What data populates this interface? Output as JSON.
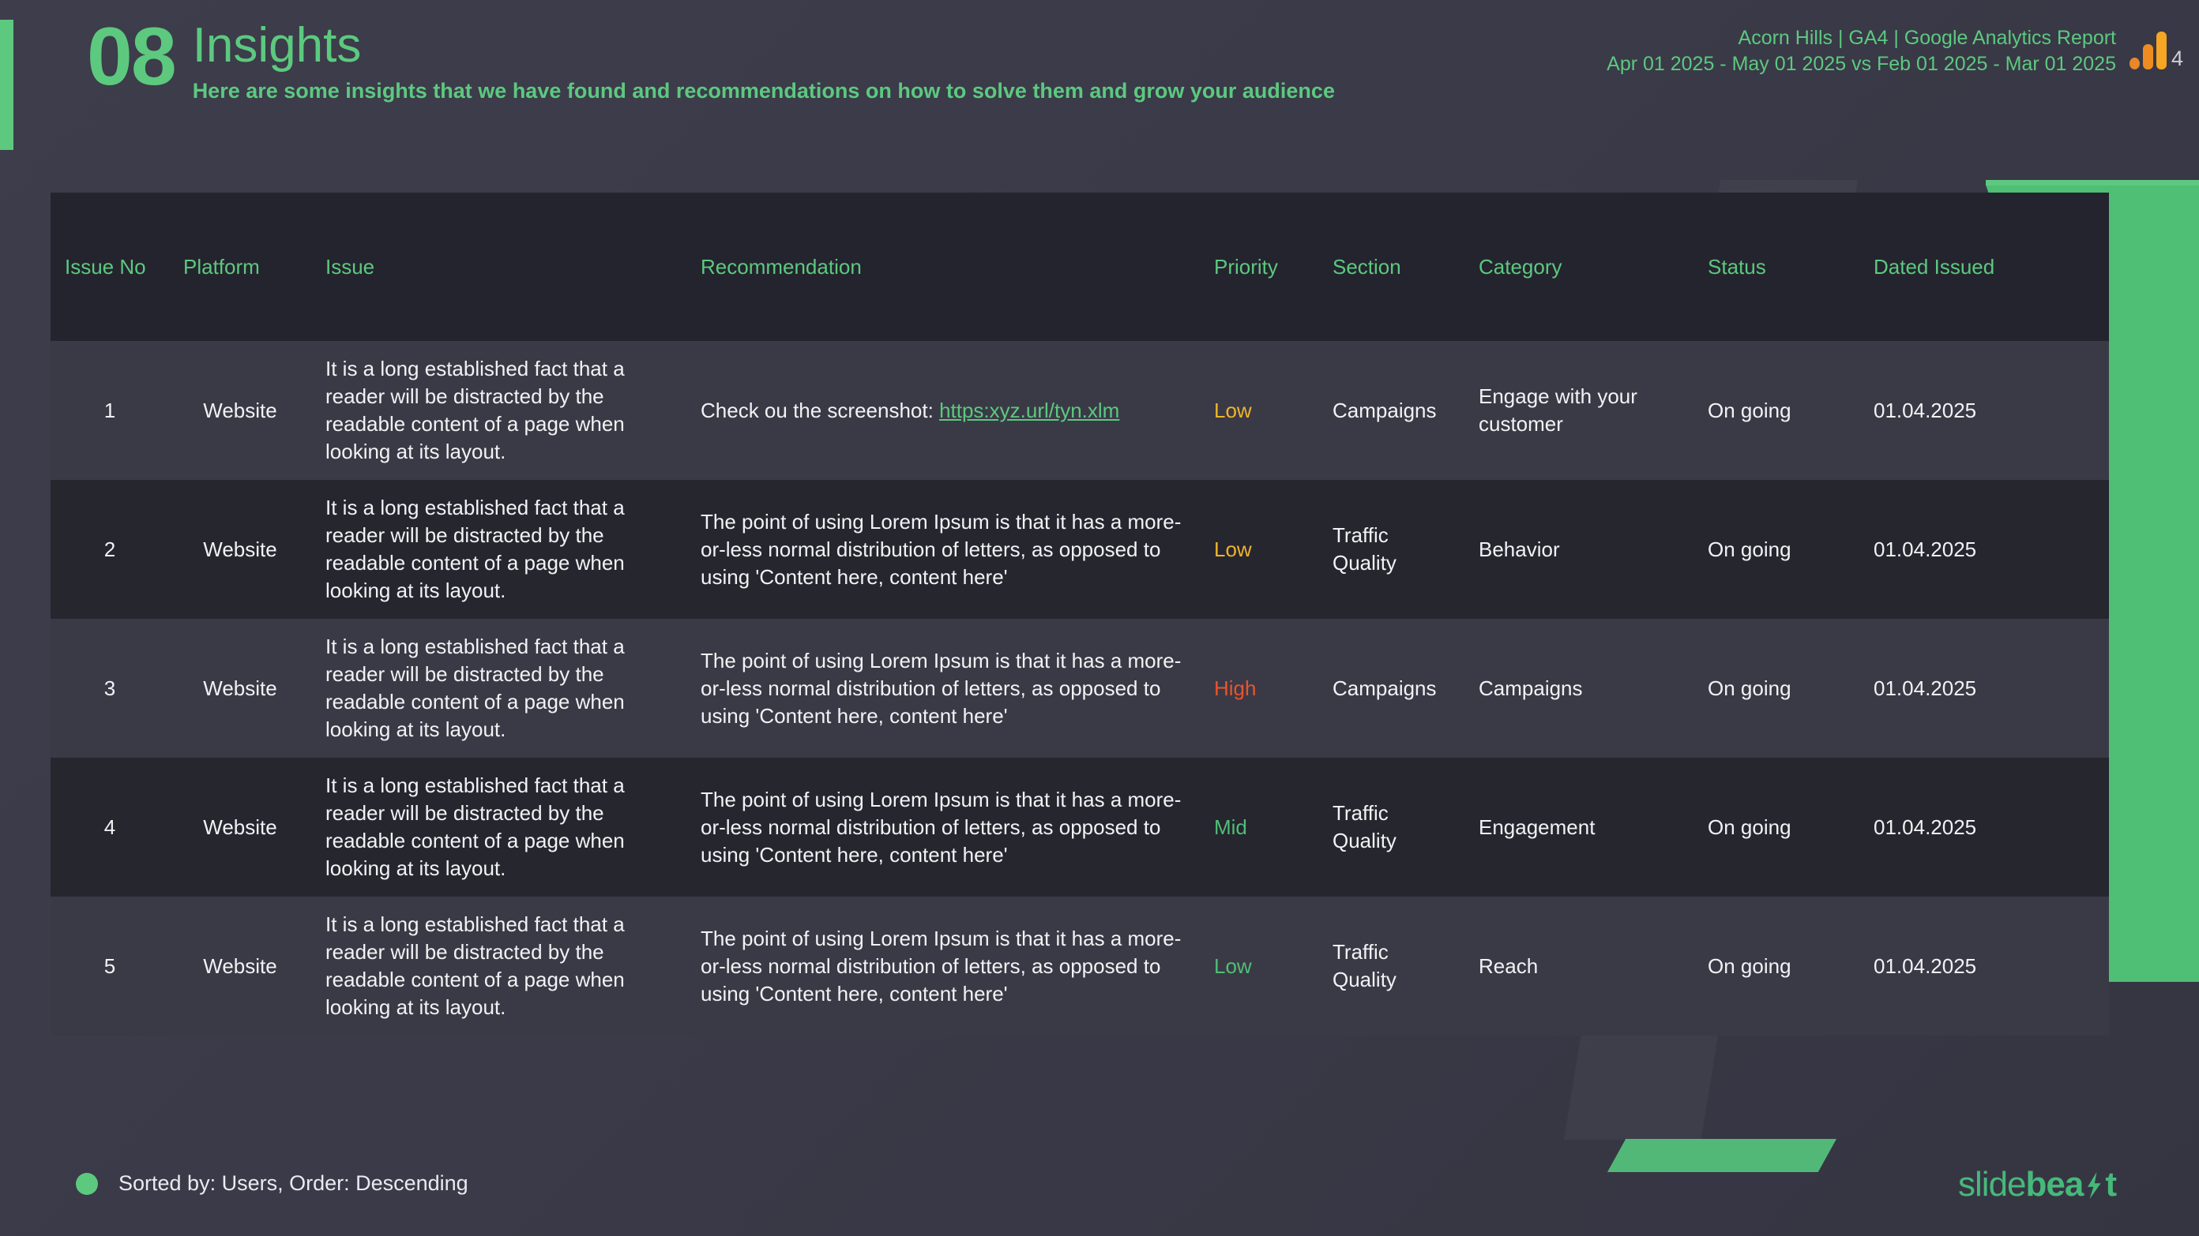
{
  "header": {
    "slide_number": "08",
    "title": "Insights",
    "subtitle": "Here are some insights that we have found and recommendations on how to solve them and grow your audience",
    "report_name": "Acorn Hills | GA4 | Google Analytics Report",
    "date_range": "Apr 01 2025 - May 01 2025 vs Feb 01 2025 - Mar 01 2025",
    "ga4_logo_label": "4"
  },
  "table": {
    "columns": [
      "Issue No",
      "Platform",
      "Issue",
      "Recommendation",
      "Priority",
      "Section",
      "Category",
      "Status",
      "Dated Issued"
    ],
    "rows": [
      {
        "issue_no": "1",
        "platform": "Website",
        "issue": "It is a long established fact that a reader will be distracted by the readable content of a page when looking at its layout.",
        "recommendation_prefix": "Check ou the screenshot: ",
        "recommendation_link": "https:xyz.url/tyn.xlm",
        "priority": "Low",
        "priority_color": "#f0b429",
        "section": "Campaigns",
        "category": "Engage with your customer",
        "status": "On going",
        "date_issued": "01.04.2025"
      },
      {
        "issue_no": "2",
        "platform": "Website",
        "issue": "It is a long established fact that a reader will be distracted by the readable content of a page when looking at its layout.",
        "recommendation_prefix": "The point of using Lorem Ipsum is that it has a more-or-less normal distribution of letters, as opposed to using 'Content here, content here'",
        "recommendation_link": "",
        "priority": "Low",
        "priority_color": "#f0b429",
        "section": "Traffic Quality",
        "category": "Behavior",
        "status": "On going",
        "date_issued": "01.04.2025"
      },
      {
        "issue_no": "3",
        "platform": "Website",
        "issue": "It is a long established fact that a reader will be distracted by the readable content of a page when looking at its layout.",
        "recommendation_prefix": "The point of using Lorem Ipsum is that it has a more-or-less normal distribution of letters, as opposed to using 'Content here, content here'",
        "recommendation_link": "",
        "priority": "High",
        "priority_color": "#e8542f",
        "section": "Campaigns",
        "category": "Campaigns",
        "status": "On going",
        "date_issued": "01.04.2025"
      },
      {
        "issue_no": "4",
        "platform": "Website",
        "issue": "It is a long established fact that a reader will be distracted by the readable content of a page when looking at its layout.",
        "recommendation_prefix": "The point of using Lorem Ipsum is that it has a more-or-less normal distribution of letters, as opposed to using 'Content here, content here'",
        "recommendation_link": "",
        "priority": "Mid",
        "priority_color": "#4fbf76",
        "section": "Traffic Quality",
        "category": "Engagement",
        "status": "On going",
        "date_issued": "01.04.2025"
      },
      {
        "issue_no": "5",
        "platform": "Website",
        "issue": "It is a long established fact that a reader will be distracted by the readable content of a page when looking at its layout.",
        "recommendation_prefix": "The point of using Lorem Ipsum is that it has a more-or-less normal distribution of letters, as opposed to using 'Content here, content here'",
        "recommendation_link": "",
        "priority": "Low",
        "priority_color": "#4fbf76",
        "section": "Traffic Quality",
        "category": "Reach",
        "status": "On going",
        "date_issued": "01.04.2025"
      }
    ]
  },
  "footer": {
    "sorted_note": "Sorted by: Users, Order: Descending",
    "brand_light": "slide",
    "brand_bold_before": "bea",
    "brand_bold_after": "t"
  },
  "colors": {
    "accent_green": "#5cc97f",
    "page_bg": "#3a3a48",
    "header_row_bg": "#24242e",
    "row_odd_bg": "#3a3a46",
    "row_even_bg": "#26262f",
    "priority_low_amber": "#f0b429",
    "priority_high": "#e8542f",
    "priority_green": "#4fbf76"
  }
}
